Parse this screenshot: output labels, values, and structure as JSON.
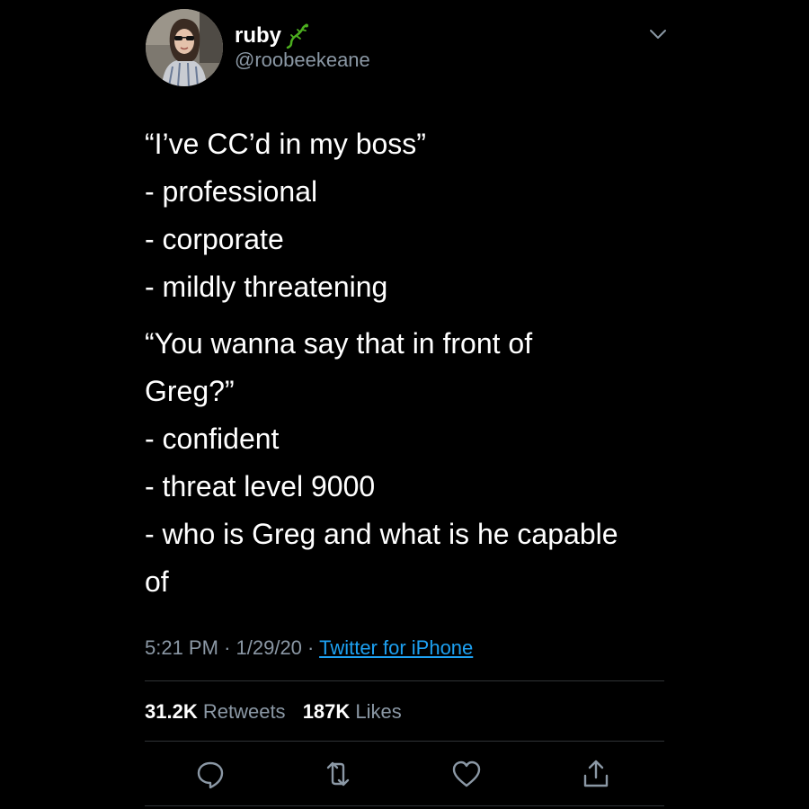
{
  "author": {
    "display_name": "ruby",
    "handle": "@roobeekeane",
    "emoji_icon": "lizard-icon",
    "avatar_icon": "profile-photo"
  },
  "tweet": {
    "lines": [
      "“I’ve CC’d in my boss”\n- professional\n- corporate\n- mildly threatening",
      "“You wanna say that in front of\nGreg?”\n- confident\n- threat level 9000\n- who is Greg and what is he capable\nof"
    ],
    "time": "5:21 PM",
    "date": "1/29/20",
    "separator": "·",
    "source": "Twitter for iPhone"
  },
  "stats": {
    "retweets_count": "31.2K",
    "retweets_label": "Retweets",
    "likes_count": "187K",
    "likes_label": "Likes"
  },
  "actions": {
    "reply_icon": "reply-icon",
    "retweet_icon": "retweet-icon",
    "like_icon": "heart-icon",
    "share_icon": "share-icon"
  },
  "colors": {
    "background": "#000000",
    "text": "#ffffff",
    "secondary": "#8b98a5",
    "link": "#1da1f2",
    "lizard": "#4caf1f",
    "divider": "#2f3336"
  }
}
